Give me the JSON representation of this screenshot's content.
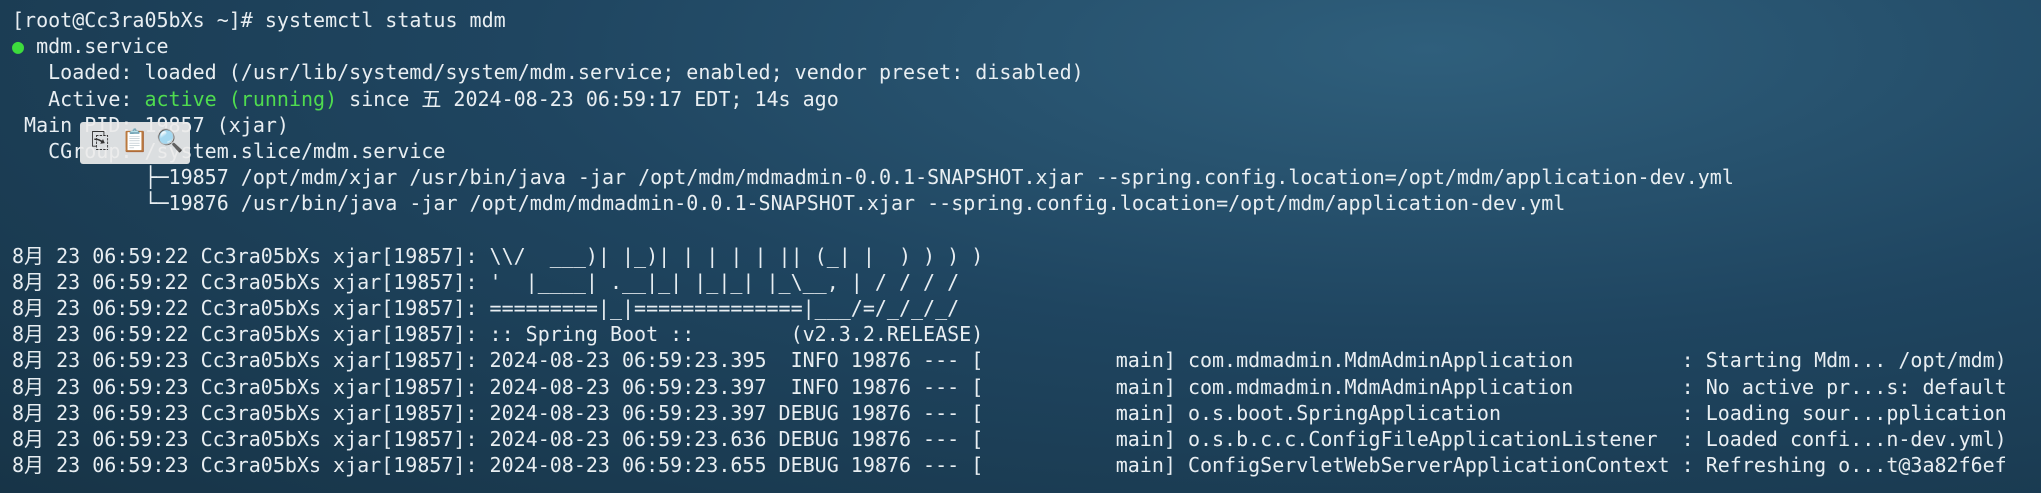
{
  "terminal": {
    "lines": [
      "[root@Cc3ra05bXs ~]# systemctl status mdm",
      "",
      "   Loaded: loaded (/usr/lib/systemd/system/mdm.service; enabled; vendor preset: disabled)",
      "   Active: ",
      " Main PID: 19857 (xjar)",
      "   CGroup: /system.slice/mdm.service",
      "           ├─19857 /opt/mdm/xjar /usr/bin/java -jar /opt/mdm/mdmadmin-0.0.1-SNAPSHOT.xjar --spring.config.location=/opt/mdm/application-dev.yml",
      "           └─19876 /usr/bin/java -jar /opt/mdm/mdmadmin-0.0.1-SNAPSHOT.xjar --spring.config.location=/opt/mdm/application-dev.yml",
      "",
      "8月 23 06:59:22 Cc3ra05bXs xjar[19857]: \\\\/  ___)| |_)| | | | | || (_| |  ) ) ) )",
      "8月 23 06:59:22 Cc3ra05bXs xjar[19857]: '  |____| .__|_| |_|_| |_\\__, | / / / /",
      "8月 23 06:59:22 Cc3ra05bXs xjar[19857]: =========|_|==============|___/=/_/_/_/",
      "8月 23 06:59:22 Cc3ra05bXs xjar[19857]: :: Spring Boot ::        (v2.3.2.RELEASE)",
      "8月 23 06:59:23 Cc3ra05bXs xjar[19857]: 2024-08-23 06:59:23.395  INFO 19876 --- [           main] com.mdmadmin.MdmAdminApplication         : Starting Mdm... /opt/mdm)",
      "8月 23 06:59:23 Cc3ra05bXs xjar[19857]: 2024-08-23 06:59:23.397  INFO 19876 --- [           main] com.mdmadmin.MdmAdminApplication         : No active pr...s: default",
      "8月 23 06:59:23 Cc3ra05bXs xjar[19857]: 2024-08-23 06:59:23.397 DEBUG 19876 --- [           main] o.s.boot.SpringApplication               : Loading sour...pplication",
      "8月 23 06:59:23 Cc3ra05bXs xjar[19857]: 2024-08-23 06:59:23.636 DEBUG 19876 --- [           main] o.s.b.c.c.ConfigFileApplicationListener  : Loaded confi...n-dev.yml)",
      "8月 23 06:59:23 Cc3ra05bXs xjar[19857]: 2024-08-23 06:59:23.655 DEBUG 19876 --- [           main] ConfigServletWebServerApplicationContext : Refreshing o...t@3a82f6ef"
    ],
    "service_name": "mdm.service",
    "service_dot": "●",
    "active_state": "active (running)",
    "active_since": " since 五 2024-08-23 06:59:17 EDT; 14s ago"
  },
  "toolbar": {
    "copy_icon": "⎘",
    "paste_icon": "📋",
    "search_icon": "🔍"
  },
  "colors": {
    "active": "#4fdc4f",
    "background": "#1f4560"
  }
}
